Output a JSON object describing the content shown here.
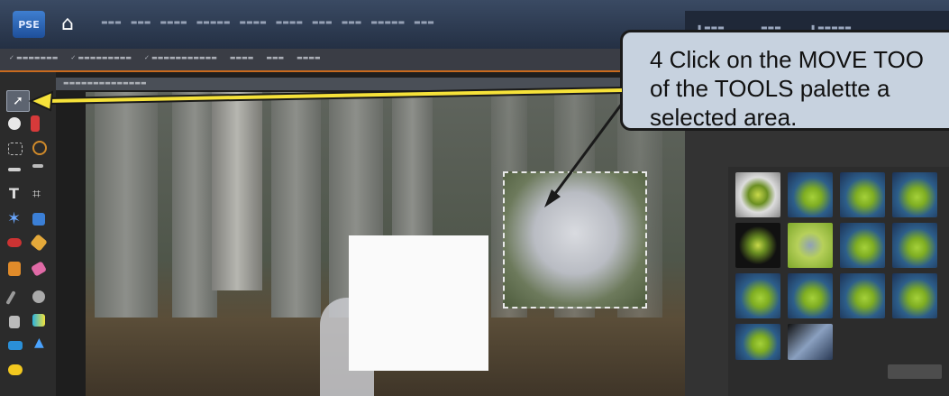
{
  "app": {
    "logo_text": "PSE",
    "home_icon": "home-icon"
  },
  "callout": {
    "text": "4  Click on the MOVE TOO\nof the TOOLS palette a\nselected area."
  },
  "colors": {
    "callout_bg": "#c7d2df",
    "arrow_yellow": "#f6e23a",
    "accent": "#c86a1e"
  }
}
